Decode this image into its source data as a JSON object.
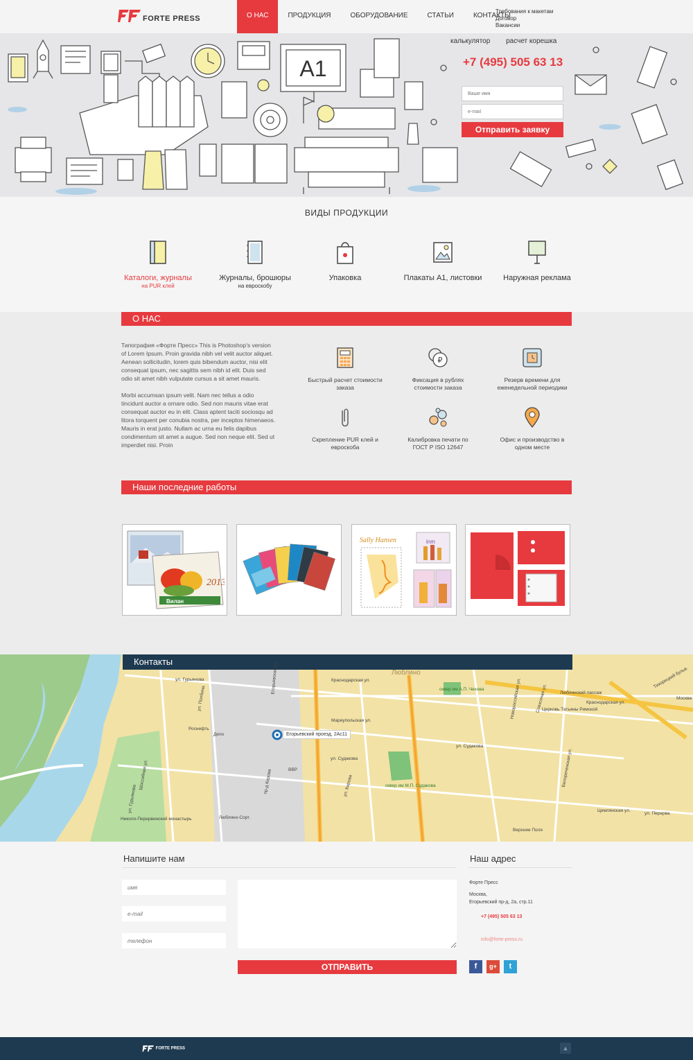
{
  "header": {
    "logo_text": "FORTE PRESS",
    "nav": [
      "О НАС",
      "ПРОДУКЦИЯ",
      "ОБОРУДОВАНИЕ",
      "СТАТЬИ",
      "КОНТАКТЫ"
    ],
    "top_links": [
      "Требования к макетам",
      "Договор",
      "Вакансии"
    ]
  },
  "hero": {
    "links": [
      "калькулятор",
      "расчет корешка"
    ],
    "phone": "+7 (495) 505 63 13",
    "name_placeholder": "Ваше имя",
    "email_placeholder": "e-mail",
    "submit": "Отправить заявку",
    "sign": "A1"
  },
  "products": {
    "title": "ВИДЫ ПРОДУКЦИИ",
    "items": [
      {
        "title": "Каталоги, журналы",
        "sub": "на PUR клей"
      },
      {
        "title": "Журналы, брошюры",
        "sub": "на евроскобу"
      },
      {
        "title": "Упаковка",
        "sub": ""
      },
      {
        "title": "Плакаты А1, листовки",
        "sub": ""
      },
      {
        "title": "Наружная реклама",
        "sub": ""
      }
    ]
  },
  "about": {
    "title": "О НАС",
    "p1": "Типография «Форте Пресс» This is Photoshop's version  of Lorem Ipsum. Proin gravida nibh vel velit auctor aliquet. Aenean sollicitudin, lorem quis bibendum auctor, nisi elit consequat ipsum, nec sagittis sem nibh id elit. Duis sed odio sit amet nibh vulputate cursus a sit amet mauris.",
    "p2": "Morbi accumsan ipsum velit. Nam nec tellus a odio tincidunt auctor a ornare odio. Sed non  mauris vitae erat consequat auctor eu in elit. Class aptent taciti sociosqu ad litora torquent per conubia nostra, per inceptos himenaeos.",
    "p3": "Mauris in erat justo. Nullam ac urna eu felis dapibus condimentum sit amet a augue. Sed non neque elit. Sed ut imperdiet nisi. Proin",
    "features": [
      "Быстрый расчет стоимости заказа",
      "Фиксация в рублях стоимости заказа",
      "Резерв времени для еженедельной периодики",
      "Скрепление PUR клей и евроскоба",
      "Калибровка печати по ГОСТ Р ISO 12647",
      "Офис и производство в одном месте"
    ]
  },
  "works": {
    "title": "Наши последние работы",
    "calendar_year": "2013",
    "calendar_brand": "Вилан",
    "brand_a": "Sally Hansen",
    "brand_b": "inm"
  },
  "contacts": {
    "title": "Контакты",
    "pin_label": "Егорьевский проезд, 2Ас11",
    "map_labels": [
      "ул. Гурьянова",
      "ул. Гурьянова",
      "ул. Полбина",
      "Депо",
      "Роснефть",
      "Краснодарская ул.",
      "Мариупольская ул.",
      "ул. Судакова",
      "ул. Судакова",
      "Люблино",
      "сквер им А.П. Чехова",
      "сквер им М.П. Судакова",
      "Люблинский пассаж",
      "Церковь Татьяны Римской",
      "Краснодарская ул.",
      "Люблино-Сорт.",
      "Николо-Перервинский монастырь",
      "Шоссейная ул.",
      "Цимлянская ул.",
      "ул. Перерва",
      "Верхние Поля",
      "Москва",
      "Тихорецкий бульв.",
      "Совхозная ул.",
      "Белореченская ул.",
      "ул. Кирова",
      "Егорьевская ул.",
      "Новороссийская ул.",
      "пр-д Кирова",
      "ВВР"
    ]
  },
  "write": {
    "title": "Напишите нам",
    "name_ph": "имя",
    "email_ph": "e-mail",
    "phone_ph": "телефон",
    "send": "ОТПРАВИТЬ",
    "addr_title": "Наш адрес",
    "company": "Форте Пресс",
    "city": "Москва,",
    "street": "Егорьевский пр-д, 2а, стр.11",
    "phone": "+7 (495) 505 63 13",
    "email": "info@forte-press.ru",
    "social": [
      "f",
      "g+",
      "t"
    ]
  },
  "footer": {
    "logo_text": "FORTE PRESS",
    "top_button": "▲"
  },
  "colors": {
    "accent": "#e63a3f",
    "navy": "#1e3a50",
    "facebook": "#3b5998",
    "google": "#dd4b39",
    "twitter": "#2fa2d6"
  }
}
